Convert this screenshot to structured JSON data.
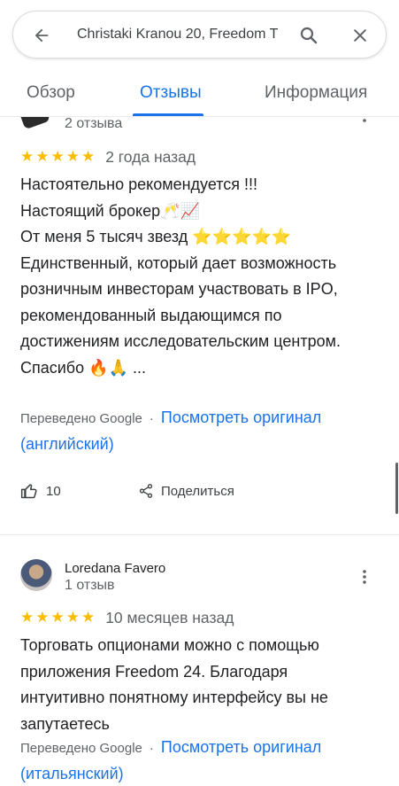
{
  "search": {
    "query": "Christaki Kranou 20, Freedom T"
  },
  "tabs": [
    {
      "label": "Обзор"
    },
    {
      "label": "Отзывы"
    },
    {
      "label": "Информация"
    }
  ],
  "reviews": [
    {
      "meta": "2 отзыва",
      "stars": "★★★★★",
      "when": "2 года назад",
      "text": "Настоятельно рекомендуется !!!\nНастоящий брокер🥂📈\nОт меня 5 тысяч звезд ⭐⭐⭐⭐⭐\nЕдинственный, который дает возможность розничным инвесторам участвовать в IPO, рекомендованный выдающимся по достижениям исследовательским центром.\nСпасибо 🔥🙏 ...",
      "translated_by": "Переведено Google",
      "dot": "·",
      "original_link": "Посмотреть оригинал (английский)",
      "likes": "10",
      "share_label": "Поделиться"
    },
    {
      "name": "Loredana Favero",
      "meta": "1 отзыв",
      "stars": "★★★★★",
      "when": "10 месяцев назад",
      "text": "Торговать опционами можно с помощью приложения Freedom 24. Благодаря интуитивно понятному интерфейсу вы не запутаетесь",
      "translated_by": "Переведено Google",
      "dot": "·",
      "original_link": "Посмотреть оригинал (итальянский)"
    }
  ],
  "colors": {
    "accent": "#1a73e8",
    "star": "#fbbc04",
    "muted": "#5f6368"
  }
}
